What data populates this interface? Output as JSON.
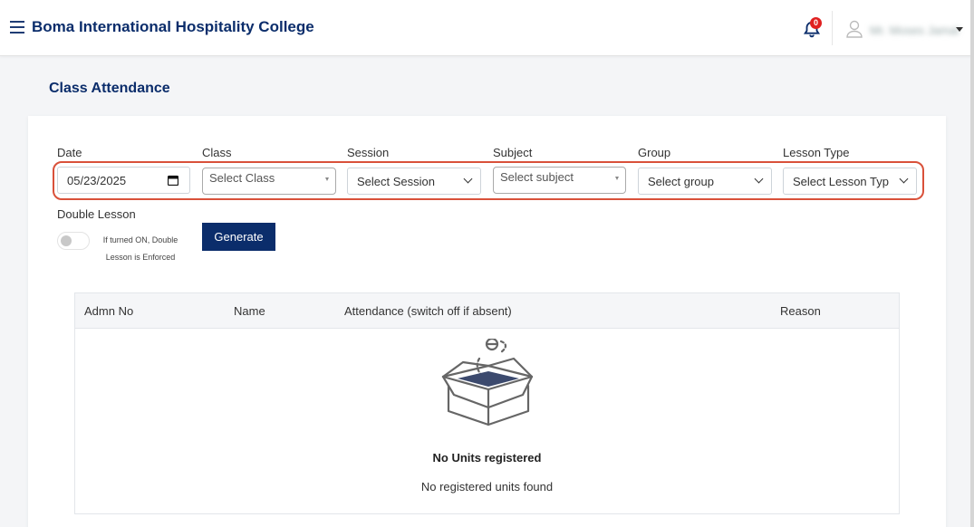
{
  "header": {
    "brand": "Boma International Hospitality College",
    "notification_count": "0",
    "user_name": "Mr. Moses Jamal"
  },
  "page": {
    "title": "Class Attendance"
  },
  "filters": {
    "date": {
      "label": "Date",
      "value": "05/23/2025"
    },
    "class": {
      "label": "Class",
      "placeholder": "Select Class"
    },
    "session": {
      "label": "Session",
      "placeholder": "Select Session"
    },
    "subject": {
      "label": "Subject",
      "placeholder": "Select subject"
    },
    "group": {
      "label": "Group",
      "placeholder": "Select group"
    },
    "lesson_type": {
      "label": "Lesson Type",
      "placeholder": "Select Lesson Typ"
    }
  },
  "double_lesson": {
    "label": "Double Lesson",
    "help": "If turned ON, Double Lesson is Enforced",
    "enabled": false
  },
  "generate_label": "Generate",
  "table": {
    "columns": [
      "Admn No",
      "Name",
      "Attendance (switch off if absent)",
      "Reason"
    ],
    "empty_title": "No Units registered",
    "empty_subtitle": "No registered units found"
  },
  "colors": {
    "brand": "#0b2d6b",
    "highlight": "#d9513a",
    "badge": "#e02020"
  },
  "icons": [
    "menu-icon",
    "bell-icon",
    "user-icon",
    "calendar-icon",
    "chevron-down-icon",
    "empty-box-icon"
  ]
}
